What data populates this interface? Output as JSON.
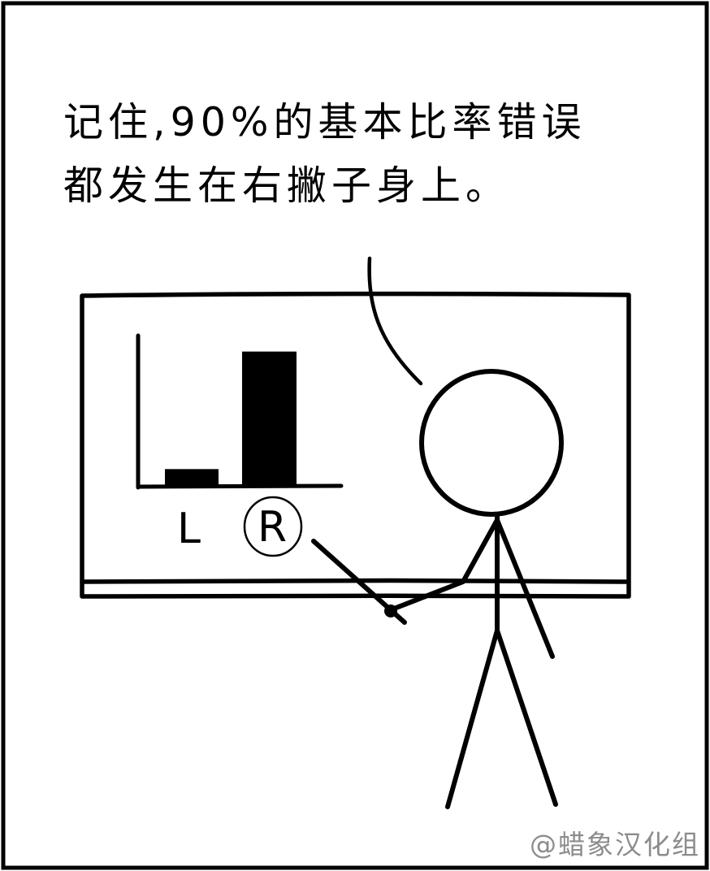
{
  "caption": {
    "line1": "记住,90%的基本比率错误",
    "line2": "都发生在右撇子身上。"
  },
  "credit": "@蜡象汉化组",
  "chart_data": {
    "type": "bar",
    "categories": [
      "L",
      "R"
    ],
    "values": [
      1,
      8
    ],
    "highlighted_category": "R",
    "title": "",
    "xlabel": "",
    "ylabel": "",
    "ylim": [
      0,
      9
    ],
    "grid": false,
    "bar_color": "#000000"
  },
  "colors": {
    "ink": "#000000",
    "background": "#ffffff",
    "credit": "#8c8c8c"
  }
}
